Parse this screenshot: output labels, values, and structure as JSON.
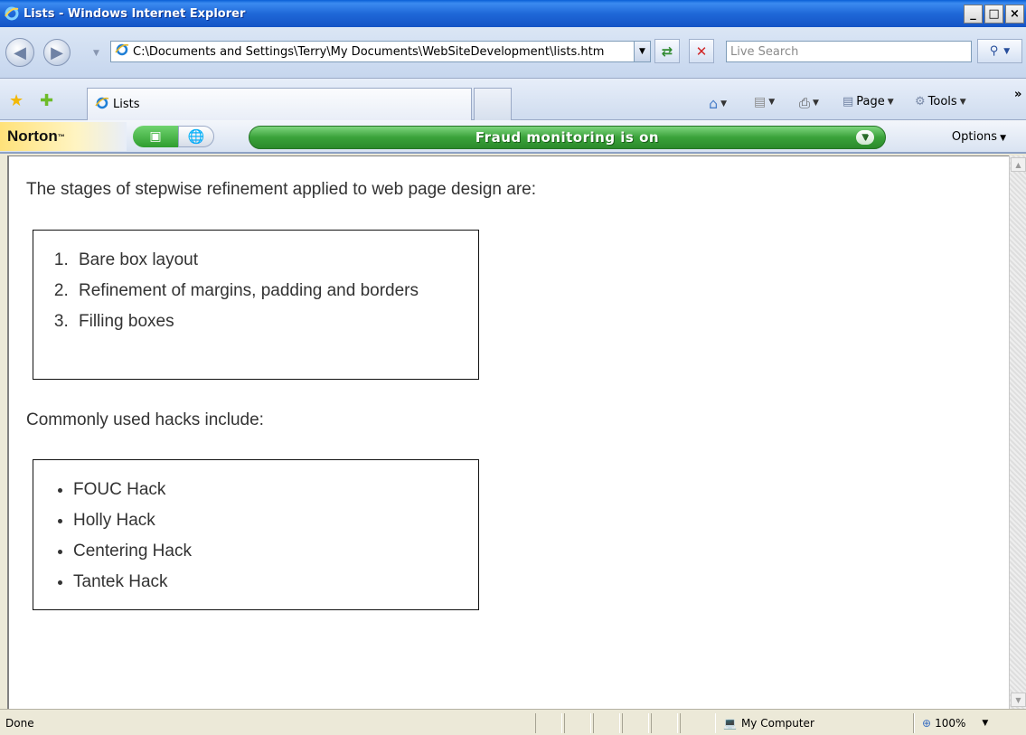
{
  "window": {
    "title": "Lists - Windows Internet Explorer",
    "min_label": "_",
    "max_label": "□",
    "close_label": "×"
  },
  "address": {
    "url": "C:\\Documents and Settings\\Terry\\My Documents\\WebSiteDevelopment\\lists.htm",
    "search_placeholder": "Live Search"
  },
  "tabs": [
    {
      "label": "Lists",
      "active": true
    }
  ],
  "commands": {
    "page_label": "Page",
    "tools_label": "Tools",
    "more_label": "»"
  },
  "norton": {
    "logo": "Norton",
    "tm": "™",
    "fraud_status": "Fraud monitoring is on",
    "options_label": "Options"
  },
  "page": {
    "intro_stages": "The stages of stepwise refinement applied to web page design are:",
    "stages": [
      "Bare box layout",
      "Refinement of margins, padding and borders",
      "Filling boxes"
    ],
    "intro_hacks": "Commonly used hacks include:",
    "hacks": [
      "FOUC Hack",
      "Holly Hack",
      "Centering Hack",
      "Tantek Hack"
    ]
  },
  "status": {
    "text": "Done",
    "zone": "My Computer",
    "zoom": "100%"
  },
  "icons": {
    "back": "back-arrow-icon",
    "forward": "forward-arrow-icon",
    "refresh": "refresh-icon",
    "stop": "stop-icon",
    "search": "search-icon",
    "favorites": "favorites-star-icon",
    "add_favorite": "add-favorites-icon",
    "home": "home-icon",
    "feeds": "feeds-icon",
    "print": "print-icon"
  },
  "colors": {
    "titlebar": "#1f68d8",
    "fraud_green": "#3aa23a"
  }
}
